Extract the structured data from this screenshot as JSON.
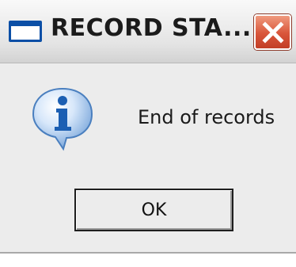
{
  "dialog": {
    "title": "RECORD STA...",
    "message": "End of records",
    "icon": "info-icon",
    "ok_label": "OK"
  },
  "titlebar": {
    "window_icon": "window-icon",
    "close_icon": "close-icon"
  },
  "colors": {
    "close_button": "#d9553a",
    "info_icon": "#2a6fc4",
    "dialog_background": "#ececec"
  }
}
